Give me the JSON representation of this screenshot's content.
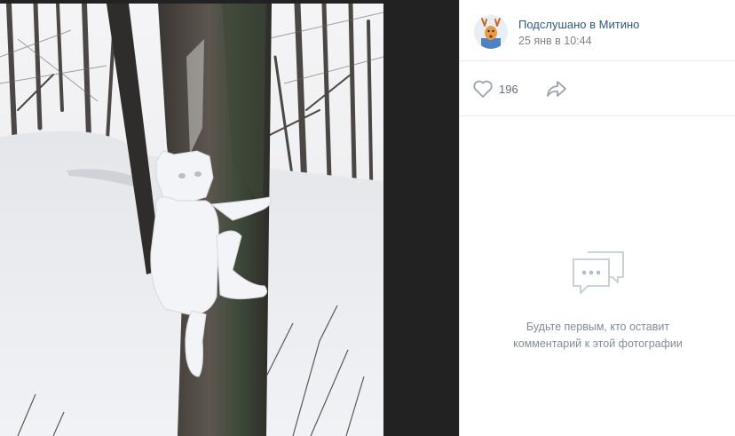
{
  "post": {
    "author": "Подслушано в Митино",
    "date": "25 янв в 10:44"
  },
  "actions": {
    "like_icon": "heart-outline-icon",
    "likes_count": "196",
    "share_icon": "share-arrow-icon"
  },
  "comments": {
    "icon": "chat-bubbles-icon",
    "empty_line1": "Будьте первым, кто оставит",
    "empty_line2": "комментарий к этой фотографии"
  },
  "colors": {
    "link": "#2a5885",
    "muted": "#828282",
    "icon": "#99a2ad"
  }
}
